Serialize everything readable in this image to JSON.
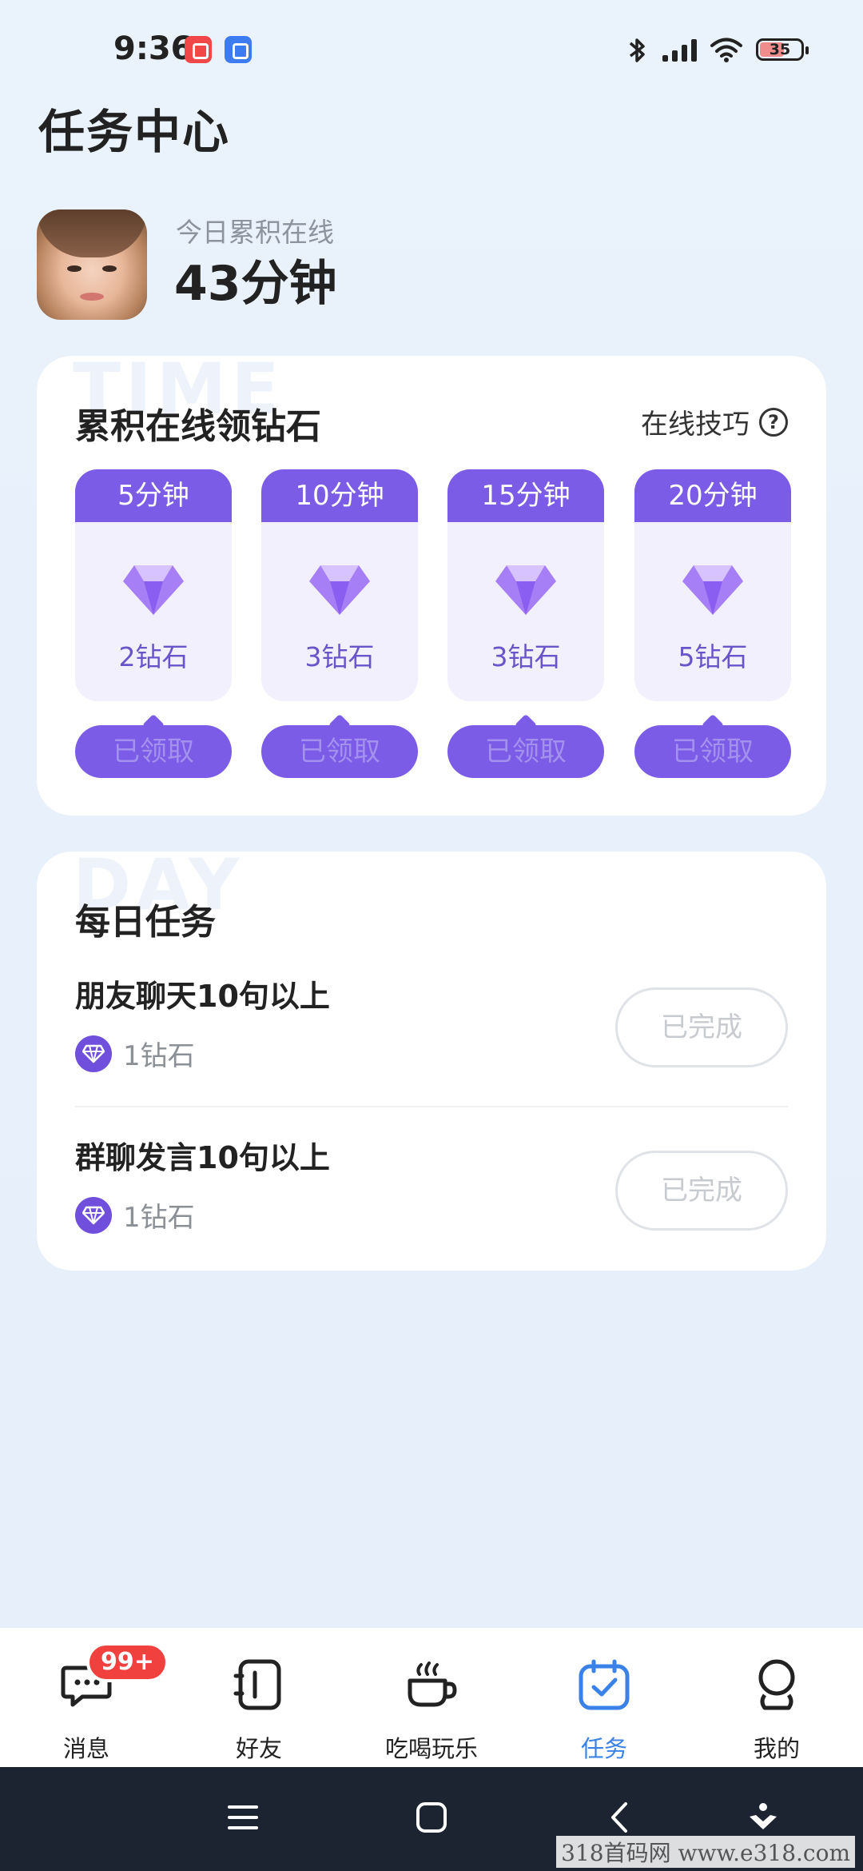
{
  "status_bar": {
    "time": "9:36",
    "battery": "35"
  },
  "page_title": "任务中心",
  "profile": {
    "online_label": "今日累积在线",
    "online_value": "43分钟"
  },
  "online_card": {
    "watermark": "TIME",
    "title": "累积在线领钻石",
    "tips_label": "在线技巧",
    "help_symbol": "?",
    "rewards": [
      {
        "duration": "5分钟",
        "amount": "2钻石",
        "button": "已领取"
      },
      {
        "duration": "10分钟",
        "amount": "3钻石",
        "button": "已领取"
      },
      {
        "duration": "15分钟",
        "amount": "3钻石",
        "button": "已领取"
      },
      {
        "duration": "20分钟",
        "amount": "5钻石",
        "button": "已领取"
      }
    ]
  },
  "daily_card": {
    "watermark": "DAY",
    "title": "每日任务",
    "tasks": [
      {
        "name": "朋友聊天10句以上",
        "reward": "1钻石",
        "status": "已完成"
      },
      {
        "name": "群聊发言10句以上",
        "reward": "1钻石",
        "status": "已完成"
      }
    ]
  },
  "bottom_nav": {
    "items": [
      {
        "label": "消息",
        "icon": "chat-icon",
        "badge": "99+"
      },
      {
        "label": "好友",
        "icon": "contacts-icon"
      },
      {
        "label": "吃喝玩乐",
        "icon": "coffee-cup-icon"
      },
      {
        "label": "任务",
        "icon": "calendar-check-icon",
        "active": true
      },
      {
        "label": "我的",
        "icon": "profile-icon"
      }
    ]
  },
  "colors": {
    "accent": "#7b5ce6",
    "active_tab": "#3a82e8",
    "badge": "#f0413e"
  },
  "footer_watermark": "318首码网 www.e318.com"
}
